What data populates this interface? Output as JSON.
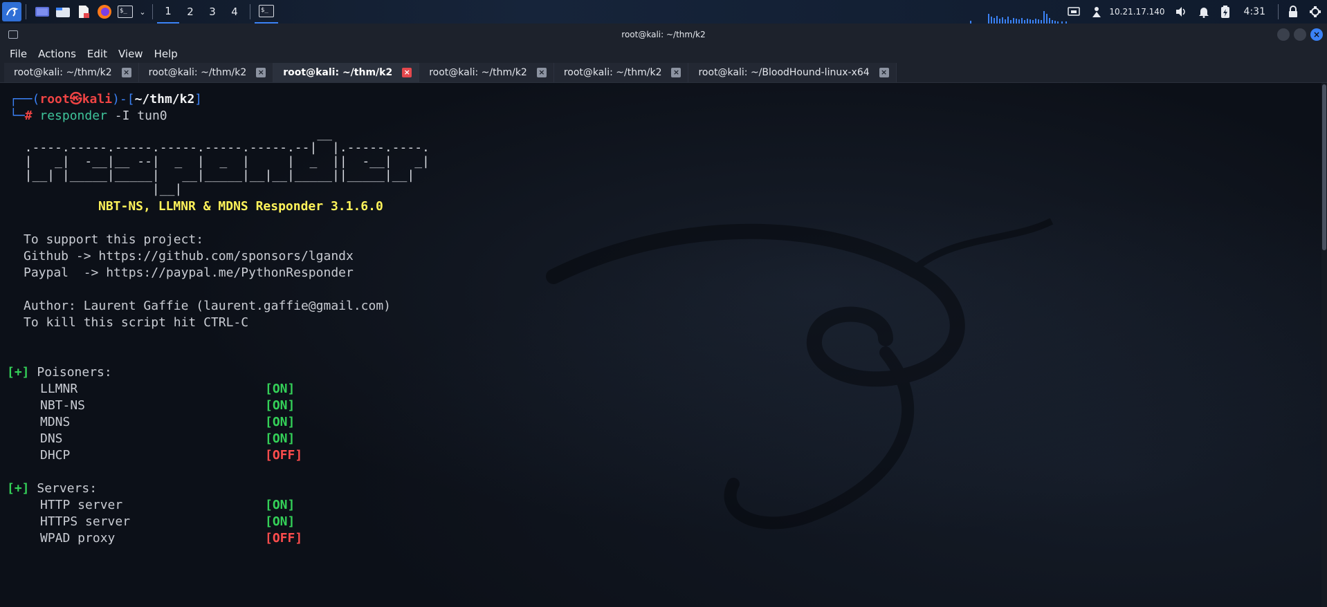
{
  "panel": {
    "workspaces": [
      "1",
      "2",
      "3",
      "4"
    ],
    "active_workspace": "1",
    "ip": "10.21.17.140",
    "clock": "4:31",
    "icons": [
      "kali-menu-icon",
      "desktop-icon",
      "file-manager-icon",
      "text-editor-icon",
      "firefox-icon",
      "terminal-icon",
      "dropdown-icon",
      "screen-icon",
      "network-icon",
      "volume-icon",
      "bell-icon",
      "battery-icon",
      "lock-icon",
      "power-icon"
    ]
  },
  "window": {
    "title": "root@kali: ~/thm/k2",
    "menu": [
      "File",
      "Actions",
      "Edit",
      "View",
      "Help"
    ],
    "tabs": [
      {
        "label": "root@kali: ~/thm/k2"
      },
      {
        "label": "root@kali: ~/thm/k2"
      },
      {
        "label": "root@kali: ~/thm/k2"
      },
      {
        "label": "root@kali: ~/thm/k2"
      },
      {
        "label": "root@kali: ~/thm/k2"
      },
      {
        "label": "root@kali: ~/BloodHound-linux-x64"
      }
    ],
    "active_tab": 2
  },
  "terminal": {
    "prompt_user": "root",
    "prompt_at": "㉿",
    "prompt_host": "kali",
    "prompt_path": "~/thm/k2",
    "command": "responder",
    "command_args": "-I tun0",
    "banner_title": "NBT-NS, LLMNR & MDNS Responder 3.1.6.0",
    "support": "To support this project:",
    "github": "Github -> https://github.com/sponsors/lgandx",
    "paypal": "Paypal  -> https://paypal.me/PythonResponder",
    "author": "Author: Laurent Gaffie (laurent.gaffie@gmail.com)",
    "kill": "To kill this script hit CTRL-C",
    "plus": "[+]",
    "poisoners_label": "Poisoners:",
    "poisoners": [
      {
        "name": "LLMNR",
        "status": "[ON]"
      },
      {
        "name": "NBT-NS",
        "status": "[ON]"
      },
      {
        "name": "MDNS",
        "status": "[ON]"
      },
      {
        "name": "DNS",
        "status": "[ON]"
      },
      {
        "name": "DHCP",
        "status": "[OFF]"
      }
    ],
    "servers_label": "Servers:",
    "servers": [
      {
        "name": "HTTP server",
        "status": "[ON]"
      },
      {
        "name": "HTTPS server",
        "status": "[ON]"
      },
      {
        "name": "WPAD proxy",
        "status": "[OFF]"
      }
    ]
  },
  "colors": {
    "accent": "#3b82f6",
    "on": "#34d058",
    "off": "#ff4d4d",
    "banner": "#fff35a"
  }
}
